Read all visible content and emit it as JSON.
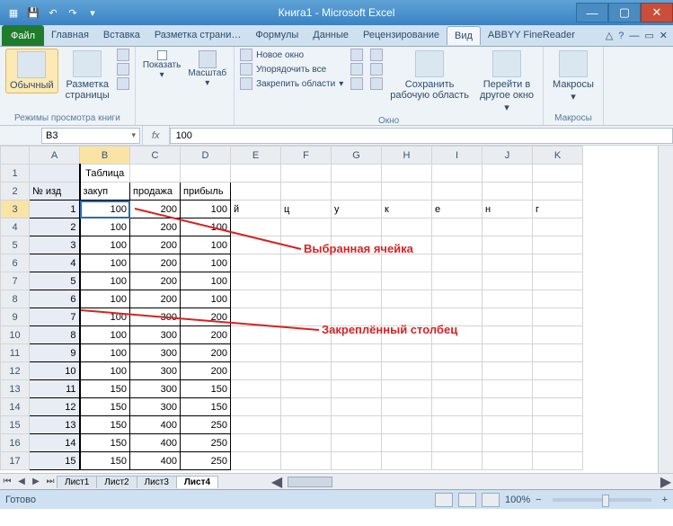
{
  "app": {
    "title": "Книга1 - Microsoft Excel"
  },
  "qat": {
    "save": "💾",
    "undo": "↶",
    "redo": "↷",
    "down": "▾"
  },
  "tabs": {
    "file": "Файл",
    "items": [
      "Главная",
      "Вставка",
      "Разметка страни…",
      "Формулы",
      "Данные",
      "Рецензирование",
      "Вид",
      "ABBYY FineReader"
    ],
    "active_index": 6
  },
  "ribbon": {
    "views": {
      "normal": "Обычный",
      "page_layout": "Разметка\nстраницы",
      "group_label": "Режимы просмотра книги"
    },
    "show_group": {
      "show": "Показать",
      "zoom": "Масштаб"
    },
    "window_group": {
      "new_window": "Новое окно",
      "arrange": "Упорядочить все",
      "freeze": "Закрепить области",
      "save_workspace": "Сохранить\nрабочую область",
      "switch": "Перейти в\nдругое окно",
      "label": "Окно"
    },
    "macros": {
      "btn": "Макросы",
      "label": "Макросы"
    }
  },
  "namebox": "B3",
  "fx": "fx",
  "formula_value": "100",
  "columns": [
    "A",
    "B",
    "C",
    "D",
    "E",
    "F",
    "G",
    "H",
    "I",
    "J",
    "K"
  ],
  "selected_col_index": 1,
  "selected_row": 3,
  "annotations": {
    "cell": "Выбранная ячейка",
    "col": "Закреплённый столбец"
  },
  "chart_data": {
    "type": "table",
    "title": "Таблица",
    "headers": [
      "№ изд",
      "закуп",
      "продажа",
      "прибыль"
    ],
    "rows": [
      [
        1,
        100,
        200,
        100
      ],
      [
        2,
        100,
        200,
        100
      ],
      [
        3,
        100,
        200,
        100
      ],
      [
        4,
        100,
        200,
        100
      ],
      [
        5,
        100,
        200,
        100
      ],
      [
        6,
        100,
        200,
        100
      ],
      [
        7,
        100,
        300,
        200
      ],
      [
        8,
        100,
        300,
        200
      ],
      [
        9,
        100,
        300,
        200
      ],
      [
        10,
        100,
        300,
        200
      ],
      [
        11,
        150,
        300,
        150
      ],
      [
        12,
        150,
        300,
        150
      ],
      [
        13,
        150,
        400,
        250
      ],
      [
        14,
        150,
        400,
        250
      ],
      [
        15,
        150,
        400,
        250
      ]
    ],
    "extra_row5": [
      "й",
      "ц",
      "у",
      "к",
      "е",
      "н",
      "г"
    ]
  },
  "sheets": {
    "items": [
      "Лист1",
      "Лист2",
      "Лист3",
      "Лист4"
    ],
    "active_index": 3
  },
  "status": {
    "ready": "Готово",
    "zoom": "100%",
    "minus": "−",
    "plus": "+"
  }
}
